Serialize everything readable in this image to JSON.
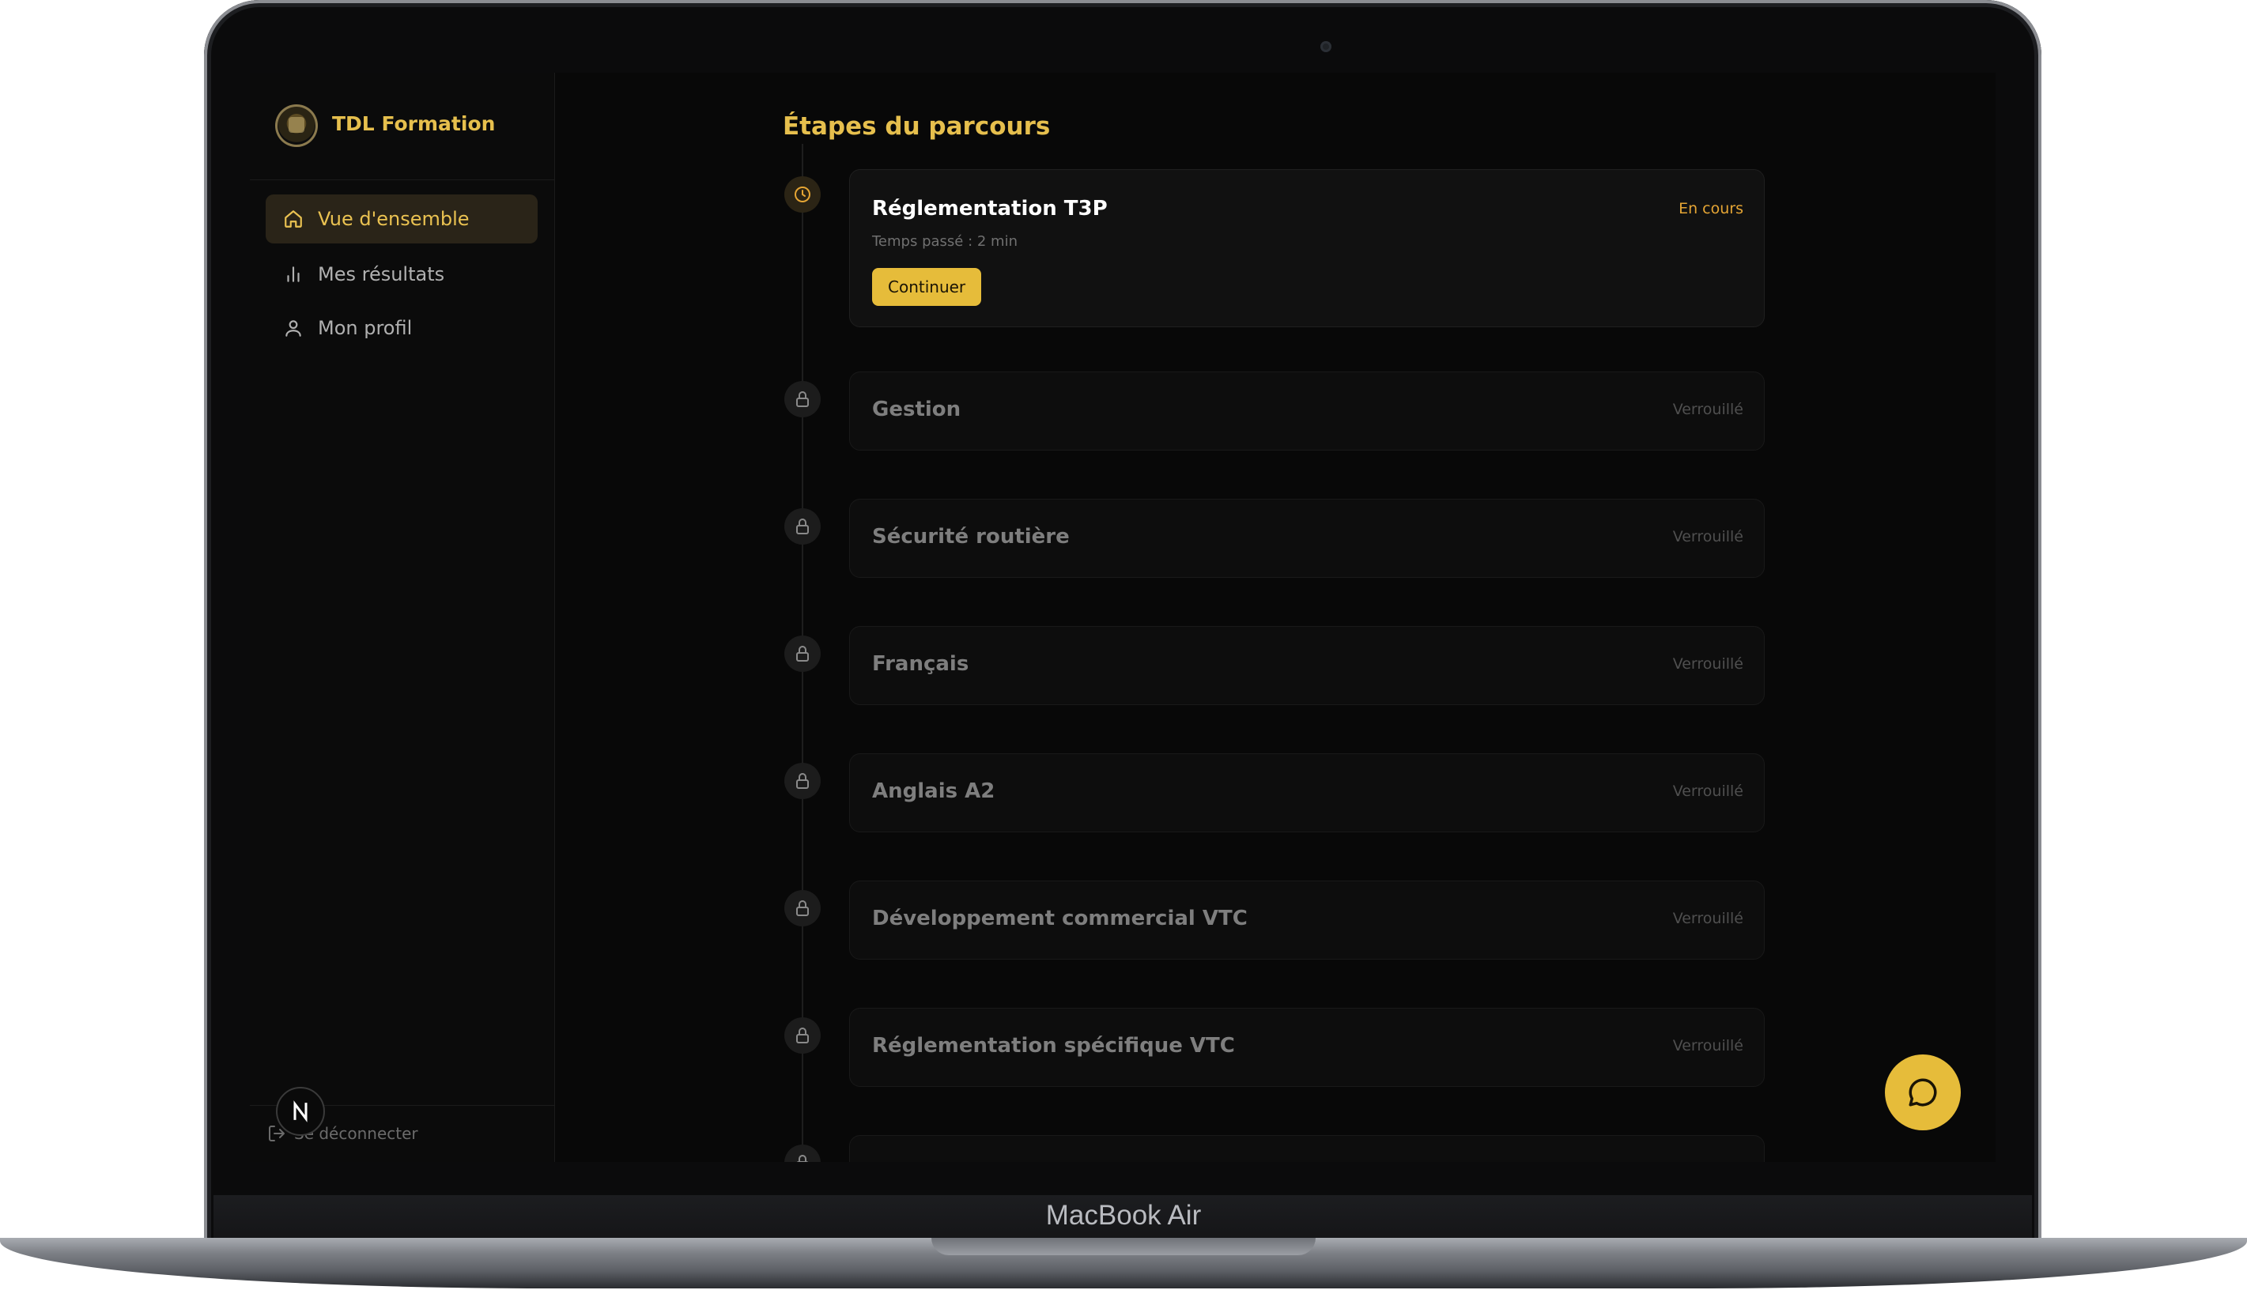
{
  "device": {
    "brand_label": "MacBook Air"
  },
  "sidebar": {
    "brand": "TDL Formation",
    "nav": [
      {
        "label": "Vue d'ensemble",
        "icon": "home-icon",
        "active": true
      },
      {
        "label": "Mes résultats",
        "icon": "bar-chart-icon",
        "active": false
      },
      {
        "label": "Mon profil",
        "icon": "user-icon",
        "active": false
      }
    ],
    "logout_label": "Se déconnecter",
    "avatar_letter": "N"
  },
  "main": {
    "title": "Étapes du parcours",
    "steps": [
      {
        "title": "Réglementation T3P",
        "status": "En cours",
        "time_spent": "Temps passé : 2 min",
        "action": "Continuer",
        "state": "current"
      },
      {
        "title": "Gestion",
        "status": "Verrouillé",
        "state": "locked"
      },
      {
        "title": "Sécurité routière",
        "status": "Verrouillé",
        "state": "locked"
      },
      {
        "title": "Français",
        "status": "Verrouillé",
        "state": "locked"
      },
      {
        "title": "Anglais A2",
        "status": "Verrouillé",
        "state": "locked"
      },
      {
        "title": "Développement commercial VTC",
        "status": "Verrouillé",
        "state": "locked"
      },
      {
        "title": "Réglementation spécifique VTC",
        "status": "Verrouillé",
        "state": "locked"
      }
    ]
  },
  "colors": {
    "accent": "#e6bc3a",
    "accent_text": "#e6bf4d",
    "status_in_progress": "#e5a534",
    "background": "#080808"
  }
}
